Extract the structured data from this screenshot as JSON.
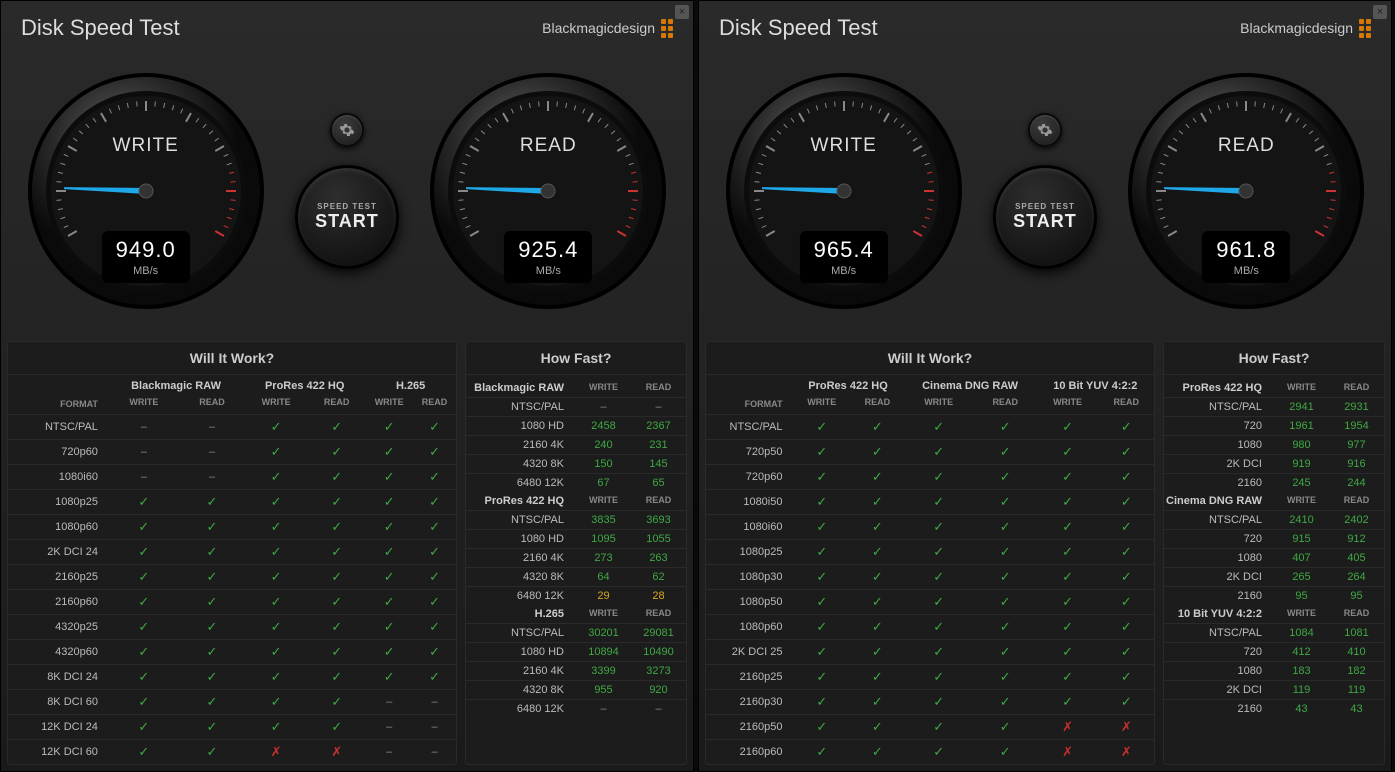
{
  "app_title": "Disk Speed Test",
  "brand": "Blackmagicdesign",
  "gauges": {
    "write_label": "WRITE",
    "read_label": "READ",
    "unit": "MB/s"
  },
  "buttons": {
    "speed_test_label": "SPEED TEST",
    "start_label": "START"
  },
  "panel_titles": {
    "will_it_work": "Will It Work?",
    "how_fast": "How Fast?",
    "format_header": "FORMAT",
    "write_header": "WRITE",
    "read_header": "READ"
  },
  "windows": [
    {
      "write_value": "949.0",
      "read_value": "925.4",
      "wiw_codecs": [
        "Blackmagic RAW",
        "ProRes 422 HQ",
        "H.265"
      ],
      "wiw_rows": [
        {
          "f": "NTSC/PAL",
          "v": [
            "d",
            "d",
            "c",
            "c",
            "c",
            "c"
          ]
        },
        {
          "f": "720p60",
          "v": [
            "d",
            "d",
            "c",
            "c",
            "c",
            "c"
          ]
        },
        {
          "f": "1080i60",
          "v": [
            "d",
            "d",
            "c",
            "c",
            "c",
            "c"
          ]
        },
        {
          "f": "1080p25",
          "v": [
            "c",
            "c",
            "c",
            "c",
            "c",
            "c"
          ]
        },
        {
          "f": "1080p60",
          "v": [
            "c",
            "c",
            "c",
            "c",
            "c",
            "c"
          ]
        },
        {
          "f": "2K DCI 24",
          "v": [
            "c",
            "c",
            "c",
            "c",
            "c",
            "c"
          ]
        },
        {
          "f": "2160p25",
          "v": [
            "c",
            "c",
            "c",
            "c",
            "c",
            "c"
          ]
        },
        {
          "f": "2160p60",
          "v": [
            "c",
            "c",
            "c",
            "c",
            "c",
            "c"
          ]
        },
        {
          "f": "4320p25",
          "v": [
            "c",
            "c",
            "c",
            "c",
            "c",
            "c"
          ]
        },
        {
          "f": "4320p60",
          "v": [
            "c",
            "c",
            "c",
            "c",
            "c",
            "c"
          ]
        },
        {
          "f": "8K DCI 24",
          "v": [
            "c",
            "c",
            "c",
            "c",
            "c",
            "c"
          ]
        },
        {
          "f": "8K DCI 60",
          "v": [
            "c",
            "c",
            "c",
            "c",
            "d",
            "d"
          ]
        },
        {
          "f": "12K DCI 24",
          "v": [
            "c",
            "c",
            "c",
            "c",
            "d",
            "d"
          ]
        },
        {
          "f": "12K DCI 60",
          "v": [
            "c",
            "c",
            "x",
            "x",
            "d",
            "d"
          ]
        }
      ],
      "hf_sections": [
        {
          "name": "Blackmagic RAW",
          "rows": [
            {
              "f": "NTSC/PAL",
              "w": "–",
              "r": "–",
              "wc": "hd",
              "rc": "hd"
            },
            {
              "f": "1080 HD",
              "w": "2458",
              "r": "2367",
              "wc": "hg",
              "rc": "hg"
            },
            {
              "f": "2160 4K",
              "w": "240",
              "r": "231",
              "wc": "hg",
              "rc": "hg"
            },
            {
              "f": "4320 8K",
              "w": "150",
              "r": "145",
              "wc": "hg",
              "rc": "hg"
            },
            {
              "f": "6480 12K",
              "w": "67",
              "r": "65",
              "wc": "hg",
              "rc": "hg"
            }
          ]
        },
        {
          "name": "ProRes 422 HQ",
          "rows": [
            {
              "f": "NTSC/PAL",
              "w": "3835",
              "r": "3693",
              "wc": "hg",
              "rc": "hg"
            },
            {
              "f": "1080 HD",
              "w": "1095",
              "r": "1055",
              "wc": "hg",
              "rc": "hg"
            },
            {
              "f": "2160 4K",
              "w": "273",
              "r": "263",
              "wc": "hg",
              "rc": "hg"
            },
            {
              "f": "4320 8K",
              "w": "64",
              "r": "62",
              "wc": "hg",
              "rc": "hg"
            },
            {
              "f": "6480 12K",
              "w": "29",
              "r": "28",
              "wc": "hy",
              "rc": "hy"
            }
          ]
        },
        {
          "name": "H.265",
          "rows": [
            {
              "f": "NTSC/PAL",
              "w": "30201",
              "r": "29081",
              "wc": "hg",
              "rc": "hg"
            },
            {
              "f": "1080 HD",
              "w": "10894",
              "r": "10490",
              "wc": "hg",
              "rc": "hg"
            },
            {
              "f": "2160 4K",
              "w": "3399",
              "r": "3273",
              "wc": "hg",
              "rc": "hg"
            },
            {
              "f": "4320 8K",
              "w": "955",
              "r": "920",
              "wc": "hg",
              "rc": "hg"
            },
            {
              "f": "6480 12K",
              "w": "–",
              "r": "–",
              "wc": "hd",
              "rc": "hd"
            }
          ]
        }
      ]
    },
    {
      "write_value": "965.4",
      "read_value": "961.8",
      "wiw_codecs": [
        "ProRes 422 HQ",
        "Cinema DNG RAW",
        "10 Bit YUV 4:2:2"
      ],
      "wiw_rows": [
        {
          "f": "NTSC/PAL",
          "v": [
            "c",
            "c",
            "c",
            "c",
            "c",
            "c"
          ]
        },
        {
          "f": "720p50",
          "v": [
            "c",
            "c",
            "c",
            "c",
            "c",
            "c"
          ]
        },
        {
          "f": "720p60",
          "v": [
            "c",
            "c",
            "c",
            "c",
            "c",
            "c"
          ]
        },
        {
          "f": "1080i50",
          "v": [
            "c",
            "c",
            "c",
            "c",
            "c",
            "c"
          ]
        },
        {
          "f": "1080i60",
          "v": [
            "c",
            "c",
            "c",
            "c",
            "c",
            "c"
          ]
        },
        {
          "f": "1080p25",
          "v": [
            "c",
            "c",
            "c",
            "c",
            "c",
            "c"
          ]
        },
        {
          "f": "1080p30",
          "v": [
            "c",
            "c",
            "c",
            "c",
            "c",
            "c"
          ]
        },
        {
          "f": "1080p50",
          "v": [
            "c",
            "c",
            "c",
            "c",
            "c",
            "c"
          ]
        },
        {
          "f": "1080p60",
          "v": [
            "c",
            "c",
            "c",
            "c",
            "c",
            "c"
          ]
        },
        {
          "f": "2K DCI 25",
          "v": [
            "c",
            "c",
            "c",
            "c",
            "c",
            "c"
          ]
        },
        {
          "f": "2160p25",
          "v": [
            "c",
            "c",
            "c",
            "c",
            "c",
            "c"
          ]
        },
        {
          "f": "2160p30",
          "v": [
            "c",
            "c",
            "c",
            "c",
            "c",
            "c"
          ]
        },
        {
          "f": "2160p50",
          "v": [
            "c",
            "c",
            "c",
            "c",
            "x",
            "x"
          ]
        },
        {
          "f": "2160p60",
          "v": [
            "c",
            "c",
            "c",
            "c",
            "x",
            "x"
          ]
        }
      ],
      "hf_sections": [
        {
          "name": "ProRes 422 HQ",
          "rows": [
            {
              "f": "NTSC/PAL",
              "w": "2941",
              "r": "2931",
              "wc": "hg",
              "rc": "hg"
            },
            {
              "f": "720",
              "w": "1961",
              "r": "1954",
              "wc": "hg",
              "rc": "hg"
            },
            {
              "f": "1080",
              "w": "980",
              "r": "977",
              "wc": "hg",
              "rc": "hg"
            },
            {
              "f": "2K DCI",
              "w": "919",
              "r": "916",
              "wc": "hg",
              "rc": "hg"
            },
            {
              "f": "2160",
              "w": "245",
              "r": "244",
              "wc": "hg",
              "rc": "hg"
            }
          ]
        },
        {
          "name": "Cinema DNG RAW",
          "rows": [
            {
              "f": "NTSC/PAL",
              "w": "2410",
              "r": "2402",
              "wc": "hg",
              "rc": "hg"
            },
            {
              "f": "720",
              "w": "915",
              "r": "912",
              "wc": "hg",
              "rc": "hg"
            },
            {
              "f": "1080",
              "w": "407",
              "r": "405",
              "wc": "hg",
              "rc": "hg"
            },
            {
              "f": "2K DCI",
              "w": "265",
              "r": "264",
              "wc": "hg",
              "rc": "hg"
            },
            {
              "f": "2160",
              "w": "95",
              "r": "95",
              "wc": "hg",
              "rc": "hg"
            }
          ]
        },
        {
          "name": "10 Bit YUV 4:2:2",
          "rows": [
            {
              "f": "NTSC/PAL",
              "w": "1084",
              "r": "1081",
              "wc": "hg",
              "rc": "hg"
            },
            {
              "f": "720",
              "w": "412",
              "r": "410",
              "wc": "hg",
              "rc": "hg"
            },
            {
              "f": "1080",
              "w": "183",
              "r": "182",
              "wc": "hg",
              "rc": "hg"
            },
            {
              "f": "2K DCI",
              "w": "119",
              "r": "119",
              "wc": "hg",
              "rc": "hg"
            },
            {
              "f": "2160",
              "w": "43",
              "r": "43",
              "wc": "hg",
              "rc": "hg"
            }
          ]
        }
      ]
    }
  ]
}
